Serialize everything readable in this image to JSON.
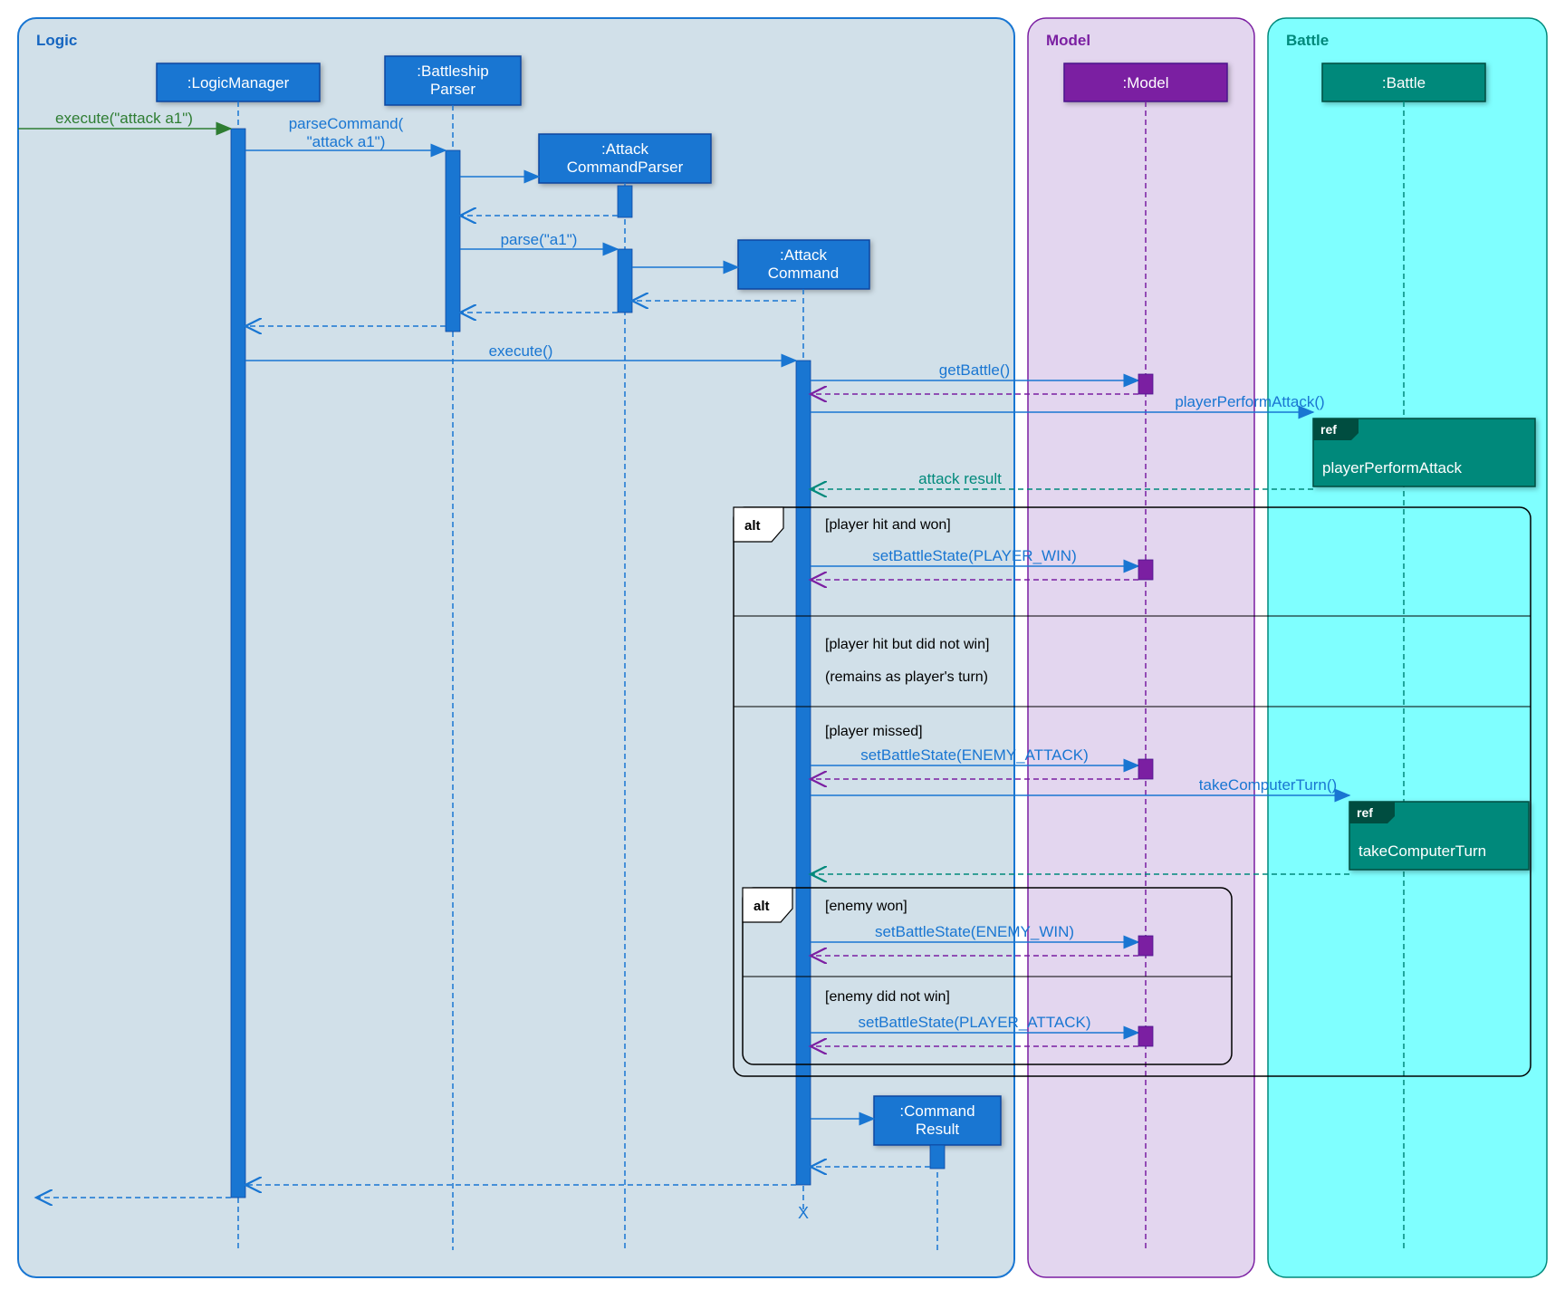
{
  "regions": {
    "logic": {
      "label": "Logic",
      "color": "#1565c0"
    },
    "model": {
      "label": "Model",
      "color": "#7b1fa2"
    },
    "battle": {
      "label": "Battle",
      "color": "#00897b"
    }
  },
  "lifelines": {
    "logicmanager": ":LogicManager",
    "battleshipparser_line1": ":Battleship",
    "battleshipparser_line2": "Parser",
    "attackparser_line1": ":Attack",
    "attackparser_line2": "CommandParser",
    "attackcmd_line1": ":Attack",
    "attackcmd_line2": "Command",
    "model": ":Model",
    "battle": ":Battle",
    "cmdresult_line1": ":Command",
    "cmdresult_line2": "Result"
  },
  "messages": {
    "execute_attack": "execute(\"attack a1\")",
    "parsecommand_line1": "parseCommand(",
    "parsecommand_line2": "\"attack a1\")",
    "parse_a1": "parse(\"a1\")",
    "execute_empty": "execute()",
    "getbattle": "getBattle()",
    "playerperformattack": "playerPerformAttack()",
    "attack_result": "attack result",
    "setbattlestate_playerwin": "setBattleState(PLAYER_WIN)",
    "setbattlestate_enemyattack": "setBattleState(ENEMY_ATTACK)",
    "takecomputerturn": "takeComputerTurn()",
    "setbattlestate_enemywin": "setBattleState(ENEMY_WIN)",
    "setbattlestate_playerattack": "setBattleState(PLAYER_ATTACK)"
  },
  "alt": {
    "alt_label": "alt",
    "guard_playerhitwon": "[player hit and won]",
    "guard_playerhitnotwon": "[player hit but did not win]",
    "note_remains": "(remains as player's turn)",
    "guard_playermissed": "[player missed]",
    "guard_enemywon": "[enemy won]",
    "guard_enemynotwon": "[enemy did not win]"
  },
  "refs": {
    "ref_label": "ref",
    "playerperformattack": "playerPerformAttack",
    "takecomputerturn": "takeComputerTurn"
  },
  "x_mark": "X",
  "chart_data": {
    "type": "sequence_diagram",
    "regions": [
      "Logic",
      "Model",
      "Battle"
    ],
    "participants": [
      {
        "name": ":LogicManager",
        "region": "Logic"
      },
      {
        "name": ":BattleshipParser",
        "region": "Logic"
      },
      {
        "name": ":AttackCommandParser",
        "region": "Logic"
      },
      {
        "name": ":AttackCommand",
        "region": "Logic"
      },
      {
        "name": ":Model",
        "region": "Model"
      },
      {
        "name": ":Battle",
        "region": "Battle"
      },
      {
        "name": ":CommandResult",
        "region": "Logic"
      }
    ],
    "interactions": [
      {
        "from": "external",
        "to": ":LogicManager",
        "message": "execute(\"attack a1\")",
        "type": "sync"
      },
      {
        "from": ":LogicManager",
        "to": ":BattleshipParser",
        "message": "parseCommand(\"attack a1\")",
        "type": "sync"
      },
      {
        "from": ":BattleshipParser",
        "to": ":AttackCommandParser",
        "message": "<<create>>",
        "type": "sync"
      },
      {
        "from": ":AttackCommandParser",
        "to": ":BattleshipParser",
        "message": "",
        "type": "return"
      },
      {
        "from": ":BattleshipParser",
        "to": ":AttackCommandParser",
        "message": "parse(\"a1\")",
        "type": "sync"
      },
      {
        "from": ":AttackCommandParser",
        "to": ":AttackCommand",
        "message": "<<create>>",
        "type": "sync"
      },
      {
        "from": ":AttackCommand",
        "to": ":AttackCommandParser",
        "message": "",
        "type": "return"
      },
      {
        "from": ":AttackCommandParser",
        "to": ":BattleshipParser",
        "message": "",
        "type": "return"
      },
      {
        "from": ":BattleshipParser",
        "to": ":LogicManager",
        "message": "",
        "type": "return"
      },
      {
        "from": ":LogicManager",
        "to": ":AttackCommand",
        "message": "execute()",
        "type": "sync"
      },
      {
        "from": ":AttackCommand",
        "to": ":Model",
        "message": "getBattle()",
        "type": "sync"
      },
      {
        "from": ":Model",
        "to": ":AttackCommand",
        "message": "",
        "type": "return"
      },
      {
        "from": ":AttackCommand",
        "to": ":Battle",
        "message": "playerPerformAttack()",
        "type": "sync",
        "ref": "playerPerformAttack"
      },
      {
        "from": ":Battle",
        "to": ":AttackCommand",
        "message": "attack result",
        "type": "return"
      },
      {
        "alt": [
          {
            "guard": "[player hit and won]",
            "steps": [
              {
                "from": ":AttackCommand",
                "to": ":Model",
                "message": "setBattleState(PLAYER_WIN)",
                "type": "sync"
              },
              {
                "from": ":Model",
                "to": ":AttackCommand",
                "message": "",
                "type": "return"
              }
            ]
          },
          {
            "guard": "[player hit but did not win]",
            "note": "(remains as player's turn)",
            "steps": []
          },
          {
            "guard": "[player missed]",
            "steps": [
              {
                "from": ":AttackCommand",
                "to": ":Model",
                "message": "setBattleState(ENEMY_ATTACK)",
                "type": "sync"
              },
              {
                "from": ":Model",
                "to": ":AttackCommand",
                "message": "",
                "type": "return"
              },
              {
                "from": ":AttackCommand",
                "to": ":Battle",
                "message": "takeComputerTurn()",
                "type": "sync",
                "ref": "takeComputerTurn"
              },
              {
                "from": ":Battle",
                "to": ":AttackCommand",
                "message": "",
                "type": "return"
              },
              {
                "alt": [
                  {
                    "guard": "[enemy won]",
                    "steps": [
                      {
                        "from": ":AttackCommand",
                        "to": ":Model",
                        "message": "setBattleState(ENEMY_WIN)",
                        "type": "sync"
                      },
                      {
                        "from": ":Model",
                        "to": ":AttackCommand",
                        "message": "",
                        "type": "return"
                      }
                    ]
                  },
                  {
                    "guard": "[enemy did not win]",
                    "steps": [
                      {
                        "from": ":AttackCommand",
                        "to": ":Model",
                        "message": "setBattleState(PLAYER_ATTACK)",
                        "type": "sync"
                      },
                      {
                        "from": ":Model",
                        "to": ":AttackCommand",
                        "message": "",
                        "type": "return"
                      }
                    ]
                  }
                ]
              }
            ]
          }
        ]
      },
      {
        "from": ":AttackCommand",
        "to": ":CommandResult",
        "message": "<<create>>",
        "type": "sync"
      },
      {
        "from": ":CommandResult",
        "to": ":AttackCommand",
        "message": "",
        "type": "return"
      },
      {
        "from": ":AttackCommand",
        "to": ":LogicManager",
        "message": "",
        "type": "return"
      },
      {
        "from": ":LogicManager",
        "to": "external",
        "message": "",
        "type": "return"
      },
      {
        "participant": ":AttackCommand",
        "type": "destroy"
      }
    ]
  }
}
